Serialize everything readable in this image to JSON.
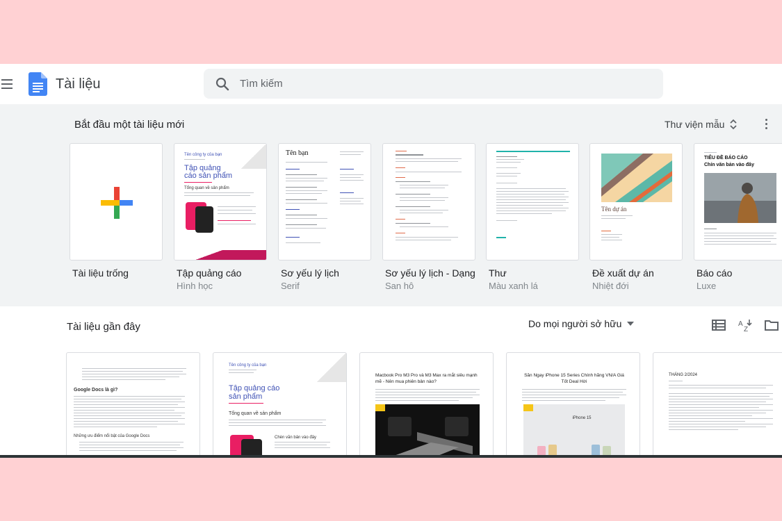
{
  "app": {
    "title": "Tài liệu"
  },
  "search": {
    "placeholder": "Tìm kiếm"
  },
  "templates_section": {
    "title": "Bắt đầu một tài liệu mới",
    "gallery_label": "Thư viện mẫu",
    "items": [
      {
        "name": "Tài liệu trống",
        "sub": ""
      },
      {
        "name": "Tập quảng cáo",
        "sub": "Hình học"
      },
      {
        "name": "Sơ yếu lý lịch",
        "sub": "Serif"
      },
      {
        "name": "Sơ yếu lý lịch - Dạng",
        "sub": "San hô"
      },
      {
        "name": "Thư",
        "sub": "Màu xanh lá"
      },
      {
        "name": "Đề xuất dự án",
        "sub": "Nhiệt đới"
      },
      {
        "name": "Báo cáo",
        "sub": "Luxe"
      }
    ],
    "thumb_text": {
      "brochure_company": "Tên công ty của bạn",
      "brochure_title": "Tập quảng cáo sản phẩm",
      "brochure_overview": "Tổng quan về sản phẩm",
      "resume_name": "Tên bạn",
      "project_title": "Tên dự án",
      "report_title": "TIÊU ĐỀ BÁO CÁO",
      "report_subtitle": "Chín văn bản vào đây"
    }
  },
  "recent_section": {
    "title": "Tài liệu gần đây",
    "owner_filter": "Do mọi người sở hữu",
    "docs": [
      {
        "heading": "Google Docs là gì?",
        "subheading": "Những ưu điểm nổi bật của Google Docs"
      },
      {
        "company": "Tên công ty của bạn",
        "title": "Tập quảng cáo sản phẩm",
        "overview": "Tổng quan về sản phẩm",
        "caption": "Chèn văn bản vào đây"
      },
      {
        "title": "Macbook Pro M3 Pro và M3 Max ra mắt siêu mạnh mẽ - Nên mua phiên bản nào?"
      },
      {
        "title": "Săn Ngay iPhone 15 Series Chính hãng VN/A Giá Tốt Deal Hời",
        "label": "iPhone 15"
      },
      {
        "title": "THÁNG 2/2024"
      }
    ]
  },
  "colors": {
    "docs_blue": "#4285f4",
    "search_bg": "#f1f3f4",
    "template_bg": "#f1f3f4",
    "frame_pink": "#ffd1d3"
  }
}
